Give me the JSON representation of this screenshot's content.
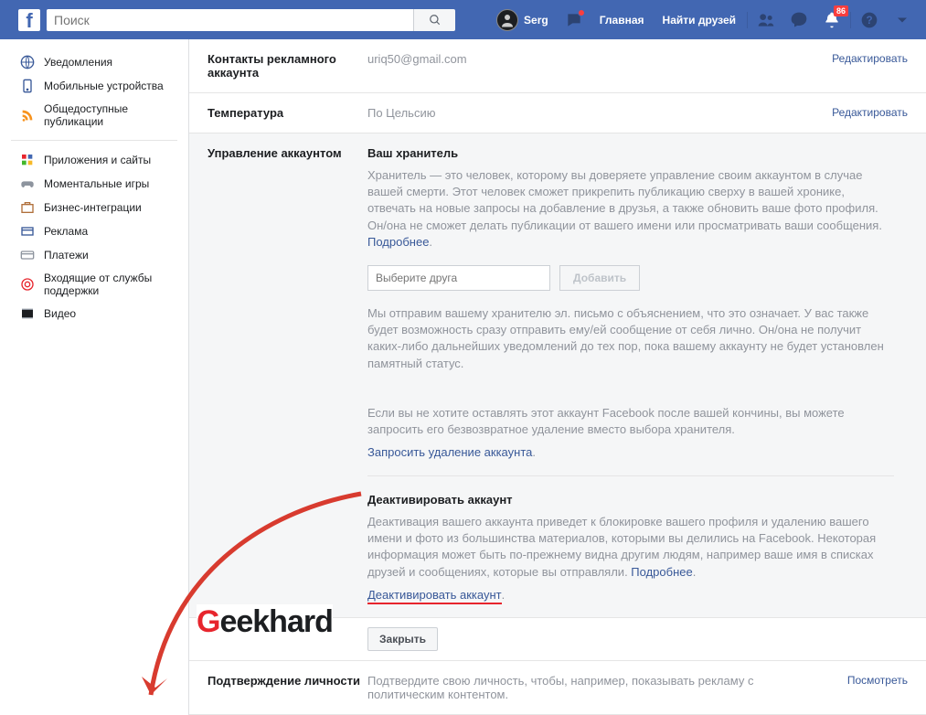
{
  "header": {
    "search_placeholder": "Поиск",
    "user_name": "Serg",
    "nav_home": "Главная",
    "nav_find_friends": "Найти друзей",
    "notif_badge": "86"
  },
  "sidebar": {
    "items": [
      {
        "label": "Уведомления",
        "icon": "globe"
      },
      {
        "label": "Мобильные устройства",
        "icon": "mobile"
      },
      {
        "label": "Общедоступные публикации",
        "icon": "rss"
      }
    ],
    "items2": [
      {
        "label": "Приложения и сайты",
        "icon": "apps"
      },
      {
        "label": "Моментальные игры",
        "icon": "games"
      },
      {
        "label": "Бизнес-интеграции",
        "icon": "biz"
      },
      {
        "label": "Реклама",
        "icon": "ads"
      },
      {
        "label": "Платежи",
        "icon": "card"
      },
      {
        "label": "Входящие от службы поддержки",
        "icon": "support"
      },
      {
        "label": "Видео",
        "icon": "video"
      }
    ]
  },
  "settings": {
    "contacts": {
      "label": "Контакты рекламного аккаунта",
      "value": "uriq50@gmail.com",
      "action": "Редактировать"
    },
    "temp": {
      "label": "Температура",
      "value": "По Цельсию",
      "action": "Редактировать"
    },
    "manage": {
      "label": "Управление аккаунтом",
      "legacy_title": "Ваш хранитель",
      "legacy_text": "Хранитель — это человек, которому вы доверяете управление своим аккаунтом в случае вашей смерти. Этот человек сможет прикрепить публикацию сверху в вашей хронике, отвечать на новые запросы на добавление в друзья, а также обновить ваше фото профиля. Он/она не сможет делать публикации от вашего имени или просматривать ваши сообщения. ",
      "learn_more": "Подробнее",
      "friend_placeholder": "Выберите друга",
      "add_btn": "Добавить",
      "legacy_note": "Мы отправим вашему хранителю эл. письмо с объяснением, что это означает. У вас также будет возможность сразу отправить ему/ей сообщение от себя лично. Он/она не получит каких-либо дальнейших уведомлений до тех пор, пока вашему аккаунту не будет установлен памятный статус.",
      "delete_note": "Если вы не хотите оставлять этот аккаунт Facebook после вашей кончины, вы можете запросить его безвозвратное удаление вместо выбора хранителя.",
      "request_delete": "Запросить удаление аккаунта",
      "deact_title": "Деактивировать аккаунт",
      "deact_text": "Деактивация вашего аккаунта приведет к блокировке вашего профиля и удалению вашего имени и фото из большинства материалов, которыми вы делились на Facebook. Некоторая информация может быть по-прежнему видна другим людям, например ваше имя в списках друзей и сообщениях, которые вы отправляли. ",
      "deact_link": "Деактивировать аккаунт",
      "close_btn": "Закрыть"
    },
    "identity": {
      "label": "Подтверждение личности",
      "value": "Подтвердите свою личность, чтобы, например, показывать рекламу с политическим контентом.",
      "action": "Посмотреть"
    }
  },
  "watermark": "eekhard"
}
